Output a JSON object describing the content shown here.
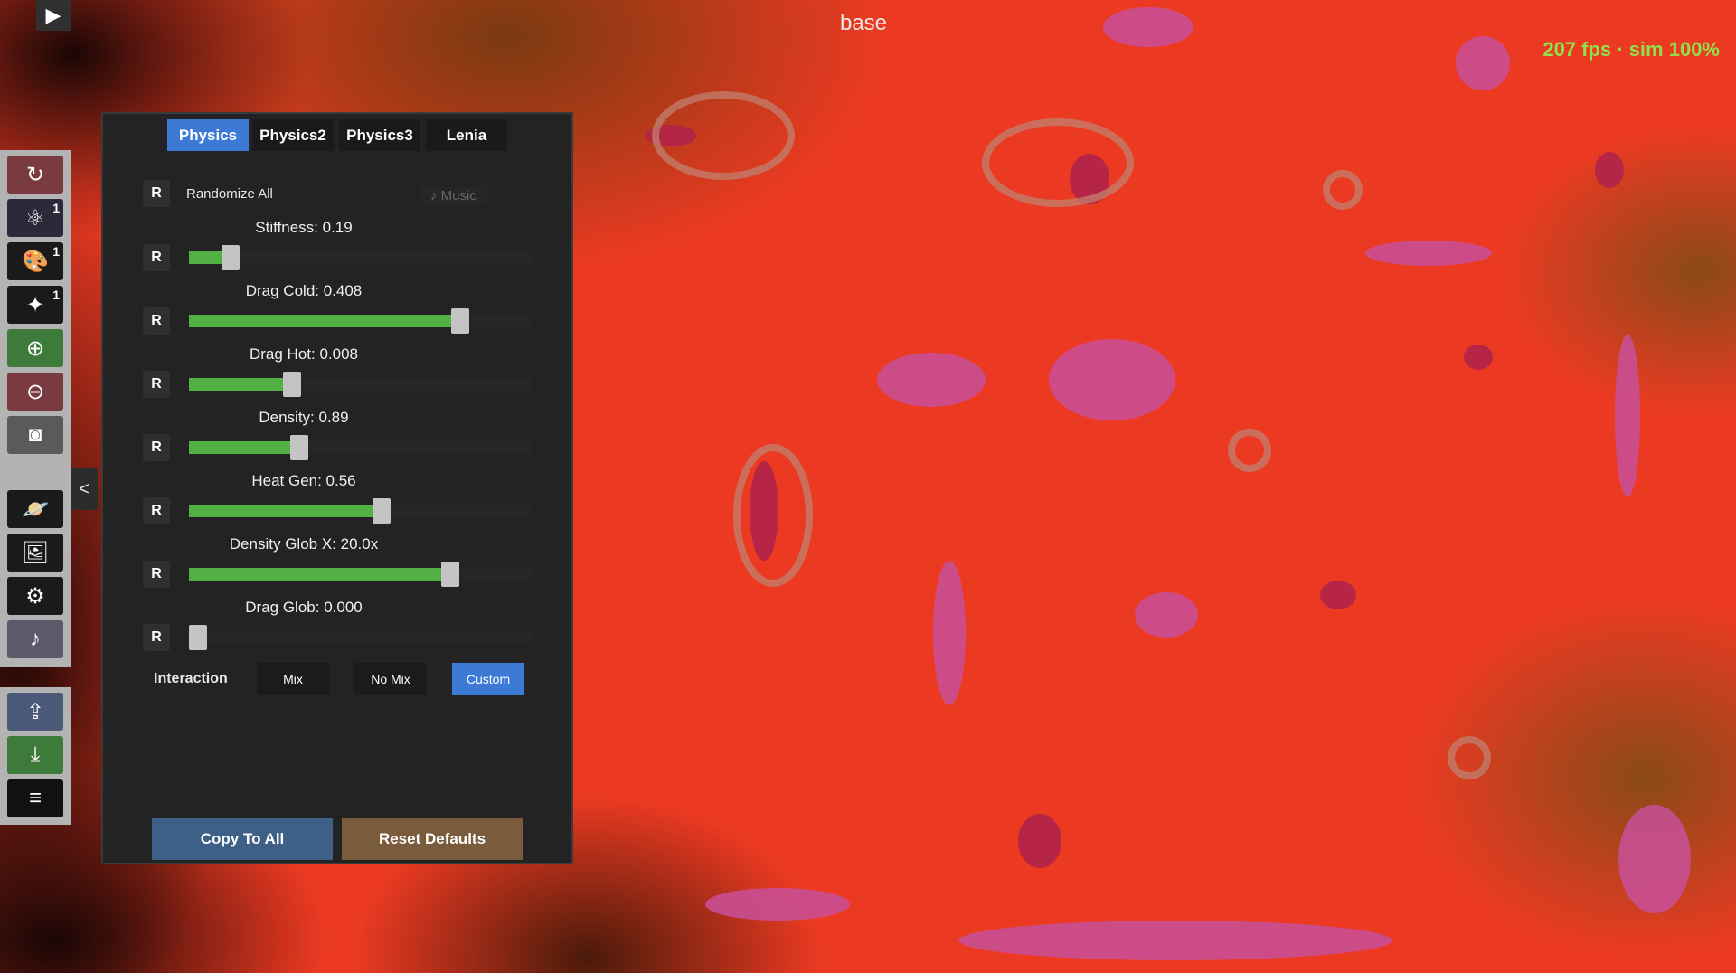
{
  "header": {
    "title": "base",
    "fps_text": "207 fps · sim 100%"
  },
  "colors": {
    "accent": "#3d7ad6",
    "slider_fill": "#52b045",
    "fps": "#8fe04a",
    "copy_button": "#3e5f86",
    "reset_button": "#7a5c3d"
  },
  "toolbar": {
    "items": [
      {
        "icon": "reset-icon",
        "glyph": "↻",
        "badge": ""
      },
      {
        "icon": "atom-icon",
        "glyph": "⚛",
        "badge": "1"
      },
      {
        "icon": "palette-icon",
        "glyph": "🎨",
        "badge": "1"
      },
      {
        "icon": "color-picker-icon",
        "glyph": "✦",
        "badge": "1"
      },
      {
        "icon": "add-icon",
        "glyph": "⊕",
        "badge": ""
      },
      {
        "icon": "remove-icon",
        "glyph": "⊖",
        "badge": ""
      },
      {
        "icon": "camera-icon",
        "glyph": "◙",
        "badge": ""
      },
      {
        "icon": "planet-icon",
        "glyph": "🪐",
        "badge": ""
      },
      {
        "icon": "image-icon",
        "glyph": "🖼",
        "badge": ""
      },
      {
        "icon": "gear-icon",
        "glyph": "⚙",
        "badge": ""
      },
      {
        "icon": "music-icon",
        "glyph": "♪",
        "badge": ""
      },
      {
        "icon": "upload-icon",
        "glyph": "⇪",
        "badge": ""
      },
      {
        "icon": "download-icon",
        "glyph": "⤓",
        "badge": ""
      },
      {
        "icon": "menu-icon",
        "glyph": "≡",
        "badge": ""
      }
    ]
  },
  "panel": {
    "tabs": [
      "Physics",
      "Physics2",
      "Physics3",
      "Lenia"
    ],
    "active_tab": "Physics",
    "reset_label": "R",
    "randomize_label": "Randomize All",
    "music_label": "♪ Music",
    "sliders": [
      {
        "label": "Stiffness: 0.19",
        "level": 0.12
      },
      {
        "label": "Drag Cold: 0.408",
        "level": 0.79
      },
      {
        "label": "Drag Hot: 0.008",
        "level": 0.3
      },
      {
        "label": "Density: 0.89",
        "level": 0.32
      },
      {
        "label": "Heat Gen: 0.56",
        "level": 0.56
      },
      {
        "label": "Density Glob X: 20.0x",
        "level": 0.76
      },
      {
        "label": "Drag Glob: 0.000",
        "level": 0.0
      }
    ],
    "interaction_label": "Interaction",
    "modes": [
      "Mix",
      "No Mix",
      "Custom"
    ],
    "active_mode": "Custom",
    "copy_label": "Copy To All",
    "reset_defaults_label": "Reset Defaults"
  }
}
